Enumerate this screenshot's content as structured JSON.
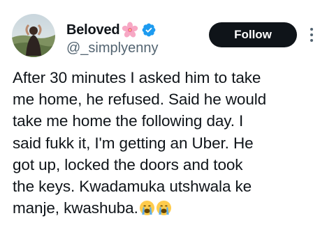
{
  "profile": {
    "display_name": "Beloved",
    "name_emoji_icon": "cherry-blossom-icon",
    "verified_icon": "verified-badge-icon",
    "verified_color": "#1d9bf0",
    "handle": "@_simplyenny",
    "avatar_icon": "user-avatar"
  },
  "actions": {
    "follow_label": "Follow",
    "more_icon": "more-vertical-icon"
  },
  "tweet": {
    "text": "After 30 minutes I asked him to take\nme home, he refused. Said he would\ntake me home the following day. I\nsaid fukk it, I'm getting an Uber. He\ngot up, locked the doors and took\nthe keys. Kwadamuka utshwala ke\nmanje, kwashuba.",
    "trailing_emojis": [
      "crying-face-icon",
      "crying-face-icon"
    ]
  },
  "colors": {
    "text_primary": "#0f1419",
    "text_secondary": "#536471",
    "button_bg": "#0f1419",
    "button_text": "#ffffff"
  }
}
